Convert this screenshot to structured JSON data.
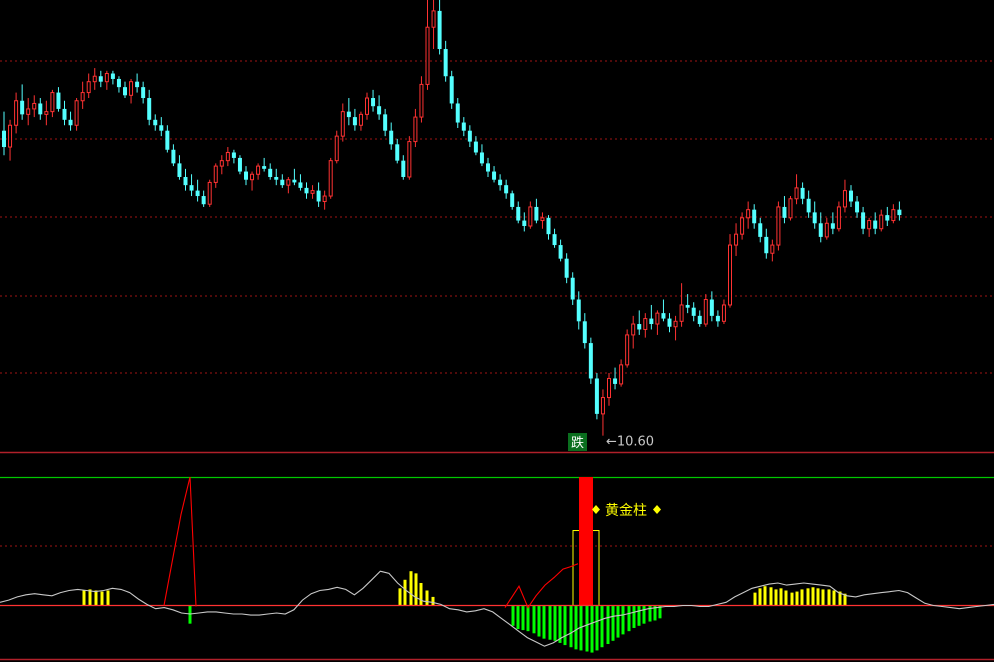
{
  "colors": {
    "background": "#000000",
    "up": "#ff3232",
    "down": "#54ffff",
    "grid": "#a01414",
    "divider": "#b0202a",
    "ind_line": "#00c800",
    "baseline": "#ff3232",
    "white_line": "#c8c8c8",
    "yellow": "#ffff00",
    "green": "#00ff00",
    "red_bar": "#ff0000",
    "annot_text": "#c8c8c8",
    "signal_bg": "#0a6e1e"
  },
  "chart_data": [
    {
      "type": "candlestick",
      "title": "",
      "ylim": [
        10.3,
        18.6
      ],
      "grid": true,
      "candles": [
        [
          16.2,
          16.55,
          15.75,
          15.9
        ],
        [
          15.9,
          16.4,
          15.65,
          16.3
        ],
        [
          16.3,
          16.9,
          16.15,
          16.75
        ],
        [
          16.75,
          17.05,
          16.4,
          16.5
        ],
        [
          16.5,
          16.8,
          16.3,
          16.6
        ],
        [
          16.6,
          16.85,
          16.45,
          16.7
        ],
        [
          16.7,
          16.8,
          16.4,
          16.5
        ],
        [
          16.5,
          16.75,
          16.3,
          16.55
        ],
        [
          16.55,
          16.95,
          16.45,
          16.9
        ],
        [
          16.9,
          17.0,
          16.55,
          16.6
        ],
        [
          16.6,
          16.75,
          16.3,
          16.4
        ],
        [
          16.4,
          16.55,
          16.2,
          16.3
        ],
        [
          16.3,
          16.8,
          16.2,
          16.75
        ],
        [
          16.75,
          17.1,
          16.6,
          16.9
        ],
        [
          16.9,
          17.25,
          16.8,
          17.1
        ],
        [
          17.1,
          17.35,
          16.95,
          17.2
        ],
        [
          17.2,
          17.3,
          17.0,
          17.1
        ],
        [
          17.1,
          17.3,
          16.95,
          17.25
        ],
        [
          17.25,
          17.3,
          17.05,
          17.15
        ],
        [
          17.15,
          17.2,
          16.9,
          17.0
        ],
        [
          17.0,
          17.1,
          16.8,
          16.85
        ],
        [
          16.85,
          17.15,
          16.7,
          17.1
        ],
        [
          17.1,
          17.25,
          16.9,
          17.0
        ],
        [
          17.0,
          17.1,
          16.7,
          16.8
        ],
        [
          16.8,
          16.95,
          16.3,
          16.4
        ],
        [
          16.4,
          16.5,
          16.2,
          16.3
        ],
        [
          16.3,
          16.45,
          16.1,
          16.2
        ],
        [
          16.2,
          16.3,
          15.8,
          15.85
        ],
        [
          15.85,
          15.95,
          15.55,
          15.6
        ],
        [
          15.6,
          15.75,
          15.3,
          15.35
        ],
        [
          15.35,
          15.5,
          15.1,
          15.2
        ],
        [
          15.2,
          15.4,
          15.0,
          15.1
        ],
        [
          15.1,
          15.3,
          14.9,
          15.0
        ],
        [
          15.0,
          15.1,
          14.8,
          14.85
        ],
        [
          14.85,
          15.3,
          14.8,
          15.25
        ],
        [
          15.25,
          15.6,
          15.15,
          15.55
        ],
        [
          15.55,
          15.75,
          15.4,
          15.65
        ],
        [
          15.65,
          15.9,
          15.55,
          15.8
        ],
        [
          15.8,
          15.85,
          15.6,
          15.7
        ],
        [
          15.7,
          15.75,
          15.4,
          15.45
        ],
        [
          15.45,
          15.55,
          15.2,
          15.3
        ],
        [
          15.3,
          15.45,
          15.1,
          15.4
        ],
        [
          15.4,
          15.6,
          15.3,
          15.55
        ],
        [
          15.55,
          15.7,
          15.45,
          15.5
        ],
        [
          15.5,
          15.6,
          15.3,
          15.35
        ],
        [
          15.35,
          15.5,
          15.2,
          15.3
        ],
        [
          15.3,
          15.4,
          15.15,
          15.2
        ],
        [
          15.2,
          15.35,
          15.05,
          15.3
        ],
        [
          15.3,
          15.5,
          15.2,
          15.25
        ],
        [
          15.25,
          15.4,
          15.1,
          15.15
        ],
        [
          15.15,
          15.25,
          14.95,
          15.05
        ],
        [
          15.05,
          15.2,
          14.95,
          15.1
        ],
        [
          15.1,
          15.25,
          14.8,
          14.9
        ],
        [
          14.9,
          15.1,
          14.75,
          15.0
        ],
        [
          15.0,
          15.7,
          14.95,
          15.65
        ],
        [
          15.65,
          16.2,
          15.6,
          16.1
        ],
        [
          16.1,
          16.7,
          16.0,
          16.55
        ],
        [
          16.55,
          16.8,
          16.3,
          16.45
        ],
        [
          16.45,
          16.6,
          16.2,
          16.3
        ],
        [
          16.3,
          16.55,
          16.2,
          16.5
        ],
        [
          16.5,
          16.9,
          16.4,
          16.8
        ],
        [
          16.8,
          16.95,
          16.55,
          16.65
        ],
        [
          16.65,
          16.85,
          16.4,
          16.5
        ],
        [
          16.5,
          16.6,
          16.1,
          16.2
        ],
        [
          16.2,
          16.35,
          15.85,
          15.95
        ],
        [
          15.95,
          16.05,
          15.6,
          15.65
        ],
        [
          15.65,
          15.75,
          15.3,
          15.35
        ],
        [
          15.35,
          16.1,
          15.3,
          16.0
        ],
        [
          16.0,
          16.6,
          15.9,
          16.45
        ],
        [
          16.45,
          17.2,
          16.35,
          17.05
        ],
        [
          17.05,
          18.6,
          16.95,
          18.1
        ],
        [
          18.1,
          18.6,
          17.7,
          18.4
        ],
        [
          18.4,
          18.6,
          17.6,
          17.7
        ],
        [
          17.7,
          17.85,
          17.1,
          17.2
        ],
        [
          17.2,
          17.3,
          16.6,
          16.7
        ],
        [
          16.7,
          16.8,
          16.25,
          16.35
        ],
        [
          16.35,
          16.45,
          16.1,
          16.2
        ],
        [
          16.2,
          16.3,
          15.9,
          16.0
        ],
        [
          16.0,
          16.1,
          15.75,
          15.8
        ],
        [
          15.8,
          15.95,
          15.55,
          15.6
        ],
        [
          15.6,
          15.7,
          15.35,
          15.45
        ],
        [
          15.45,
          15.55,
          15.25,
          15.3
        ],
        [
          15.3,
          15.4,
          15.1,
          15.2
        ],
        [
          15.2,
          15.3,
          14.95,
          15.05
        ],
        [
          15.05,
          15.1,
          14.75,
          14.8
        ],
        [
          14.8,
          14.9,
          14.5,
          14.55
        ],
        [
          14.55,
          14.7,
          14.35,
          14.45
        ],
        [
          14.45,
          14.9,
          14.4,
          14.8
        ],
        [
          14.8,
          14.95,
          14.5,
          14.55
        ],
        [
          14.55,
          14.7,
          14.4,
          14.6
        ],
        [
          14.6,
          14.65,
          14.2,
          14.3
        ],
        [
          14.3,
          14.4,
          14.05,
          14.1
        ],
        [
          14.1,
          14.2,
          13.8,
          13.85
        ],
        [
          13.85,
          13.95,
          13.4,
          13.5
        ],
        [
          13.5,
          13.6,
          13.0,
          13.1
        ],
        [
          13.1,
          13.25,
          12.55,
          12.7
        ],
        [
          12.7,
          12.85,
          12.2,
          12.3
        ],
        [
          12.3,
          12.4,
          11.55,
          11.65
        ],
        [
          11.65,
          11.75,
          10.9,
          11.0
        ],
        [
          11.0,
          11.45,
          10.6,
          11.3
        ],
        [
          11.3,
          11.75,
          11.15,
          11.65
        ],
        [
          11.65,
          11.85,
          11.45,
          11.55
        ],
        [
          11.55,
          12.0,
          11.5,
          11.9
        ],
        [
          11.9,
          12.55,
          11.85,
          12.45
        ],
        [
          12.45,
          12.8,
          12.2,
          12.65
        ],
        [
          12.65,
          12.9,
          12.45,
          12.55
        ],
        [
          12.55,
          12.85,
          12.4,
          12.75
        ],
        [
          12.75,
          13.0,
          12.55,
          12.65
        ],
        [
          12.65,
          12.9,
          12.45,
          12.85
        ],
        [
          12.85,
          13.1,
          12.7,
          12.75
        ],
        [
          12.75,
          12.85,
          12.5,
          12.6
        ],
        [
          12.6,
          12.8,
          12.35,
          12.7
        ],
        [
          12.7,
          13.4,
          12.6,
          13.0
        ],
        [
          13.0,
          13.2,
          12.85,
          12.95
        ],
        [
          12.95,
          13.05,
          12.7,
          12.8
        ],
        [
          12.8,
          12.9,
          12.6,
          12.65
        ],
        [
          12.65,
          13.2,
          12.6,
          13.1
        ],
        [
          13.1,
          13.25,
          12.7,
          12.8
        ],
        [
          12.8,
          12.9,
          12.6,
          12.7
        ],
        [
          12.7,
          13.1,
          12.65,
          13.0
        ],
        [
          13.0,
          14.3,
          12.95,
          14.1
        ],
        [
          14.1,
          14.5,
          13.9,
          14.3
        ],
        [
          14.3,
          14.7,
          14.2,
          14.6
        ],
        [
          14.6,
          14.9,
          14.4,
          14.75
        ],
        [
          14.75,
          14.85,
          14.4,
          14.5
        ],
        [
          14.5,
          14.6,
          14.15,
          14.25
        ],
        [
          14.25,
          14.4,
          13.85,
          13.95
        ],
        [
          13.95,
          14.2,
          13.8,
          14.1
        ],
        [
          14.1,
          14.9,
          14.0,
          14.8
        ],
        [
          14.8,
          15.0,
          14.5,
          14.6
        ],
        [
          14.6,
          15.0,
          14.55,
          14.95
        ],
        [
          14.95,
          15.4,
          14.85,
          15.15
        ],
        [
          15.15,
          15.25,
          14.85,
          14.95
        ],
        [
          14.95,
          15.1,
          14.6,
          14.7
        ],
        [
          14.7,
          14.9,
          14.4,
          14.5
        ],
        [
          14.5,
          14.7,
          14.15,
          14.25
        ],
        [
          14.25,
          14.6,
          14.2,
          14.5
        ],
        [
          14.5,
          14.7,
          14.3,
          14.4
        ],
        [
          14.4,
          14.9,
          14.35,
          14.8
        ],
        [
          14.8,
          15.3,
          14.7,
          15.1
        ],
        [
          15.1,
          15.2,
          14.8,
          14.9
        ],
        [
          14.9,
          15.0,
          14.6,
          14.7
        ],
        [
          14.7,
          14.8,
          14.3,
          14.4
        ],
        [
          14.4,
          14.6,
          14.25,
          14.55
        ],
        [
          14.55,
          14.7,
          14.3,
          14.4
        ],
        [
          14.4,
          14.75,
          14.35,
          14.65
        ],
        [
          14.65,
          14.8,
          14.45,
          14.55
        ],
        [
          14.55,
          14.85,
          14.5,
          14.75
        ],
        [
          14.75,
          14.9,
          14.55,
          14.65
        ]
      ],
      "annotations": {
        "low_label": "←10.60",
        "low_index": 99,
        "signal_label": "跌"
      }
    },
    {
      "type": "indicator",
      "title": "",
      "ylim": [
        -5,
        12
      ],
      "white_line": [
        0.3,
        0.5,
        0.8,
        1.0,
        1.1,
        1.0,
        0.9,
        1.2,
        1.4,
        1.5,
        1.4,
        1.3,
        1.4,
        1.6,
        1.5,
        1.2,
        0.6,
        0.1,
        -0.3,
        -0.2,
        -0.4,
        -0.7,
        -0.8,
        -0.7,
        -0.6,
        -0.6,
        -0.7,
        -0.8,
        -0.8,
        -0.9,
        -0.9,
        -0.8,
        -0.7,
        -0.8,
        -0.4,
        0.5,
        1.1,
        1.4,
        1.5,
        1.7,
        1.5,
        1.0,
        1.6,
        2.4,
        3.2,
        3.0,
        2.1,
        1.4,
        0.8,
        0.4,
        0.3,
        0.1,
        -0.3,
        -0.4,
        -0.6,
        -0.5,
        -0.3,
        -0.6,
        -1.2,
        -1.8,
        -2.4,
        -3.0,
        -3.4,
        -3.8,
        -3.5,
        -3.0,
        -2.6,
        -2.1,
        -1.8,
        -1.5,
        -1.2,
        -1.0,
        -0.9,
        -0.7,
        -0.5,
        -0.3,
        -0.2,
        -0.1,
        -0.1,
        0.0,
        0.0,
        -0.1,
        -0.1,
        0.1,
        0.3,
        0.8,
        1.2,
        1.6,
        1.8,
        2.0,
        2.1,
        1.9,
        2.0,
        2.1,
        2.0,
        1.9,
        1.8,
        1.2,
        0.9,
        0.8,
        1.0,
        1.1,
        1.2,
        1.3,
        1.4,
        1.2,
        0.7,
        0.2,
        0.0,
        -0.1,
        -0.2,
        -0.3,
        -0.2,
        -0.1,
        0.0,
        0.1
      ],
      "red_line": [
        [
          164,
          0
        ],
        [
          171,
          3.5
        ],
        [
          181,
          8.5
        ],
        [
          190,
          12.0
        ],
        [
          196,
          -0.1
        ],
        [
          505,
          -0.2
        ],
        [
          512,
          0.8
        ],
        [
          519,
          1.8
        ],
        [
          528,
          -0.2
        ],
        [
          536,
          0.9
        ],
        [
          545,
          1.9
        ],
        [
          554,
          2.6
        ],
        [
          563,
          3.4
        ],
        [
          570,
          3.6
        ],
        [
          578,
          3.9
        ]
      ],
      "yellow_bars": [
        [
          84,
          1.4
        ],
        [
          90,
          1.5
        ],
        [
          96,
          1.4
        ],
        [
          102,
          1.3
        ],
        [
          108,
          1.4
        ],
        [
          400,
          1.6
        ],
        [
          405,
          2.4
        ],
        [
          411,
          3.2
        ],
        [
          416,
          3.0
        ],
        [
          421,
          2.1
        ],
        [
          427,
          1.4
        ],
        [
          433,
          0.8
        ],
        [
          755,
          1.2
        ],
        [
          760,
          1.6
        ],
        [
          765,
          1.8
        ],
        [
          771,
          1.7
        ],
        [
          776,
          1.5
        ],
        [
          781,
          1.6
        ],
        [
          786,
          1.4
        ],
        [
          792,
          1.2
        ],
        [
          797,
          1.3
        ],
        [
          802,
          1.5
        ],
        [
          808,
          1.6
        ],
        [
          813,
          1.7
        ],
        [
          818,
          1.6
        ],
        [
          823,
          1.5
        ],
        [
          829,
          1.5
        ],
        [
          834,
          1.4
        ],
        [
          840,
          1.3
        ],
        [
          845,
          1.1
        ]
      ],
      "green_bars": [
        [
          190,
          -1.7
        ],
        [
          513,
          -1.9
        ],
        [
          518,
          -2.2
        ],
        [
          523,
          -2.3
        ],
        [
          528,
          -2.4
        ],
        [
          534,
          -2.6
        ],
        [
          539,
          -2.9
        ],
        [
          544,
          -3.1
        ],
        [
          550,
          -3.2
        ],
        [
          555,
          -3.3
        ],
        [
          560,
          -3.5
        ],
        [
          565,
          -3.7
        ],
        [
          571,
          -3.9
        ],
        [
          576,
          -4.1
        ],
        [
          581,
          -4.2
        ],
        [
          587,
          -4.3
        ],
        [
          592,
          -4.4
        ],
        [
          597,
          -4.2
        ],
        [
          602,
          -3.9
        ],
        [
          608,
          -3.6
        ],
        [
          613,
          -3.3
        ],
        [
          618,
          -3.0
        ],
        [
          623,
          -2.7
        ],
        [
          629,
          -2.4
        ],
        [
          634,
          -2.1
        ],
        [
          639,
          -1.9
        ],
        [
          644,
          -1.7
        ],
        [
          650,
          -1.5
        ],
        [
          655,
          -1.4
        ],
        [
          660,
          -1.2
        ]
      ],
      "gold_bar": {
        "label": "黄金柱",
        "value": 12.0
      },
      "gold_box_value": 7.0
    }
  ]
}
